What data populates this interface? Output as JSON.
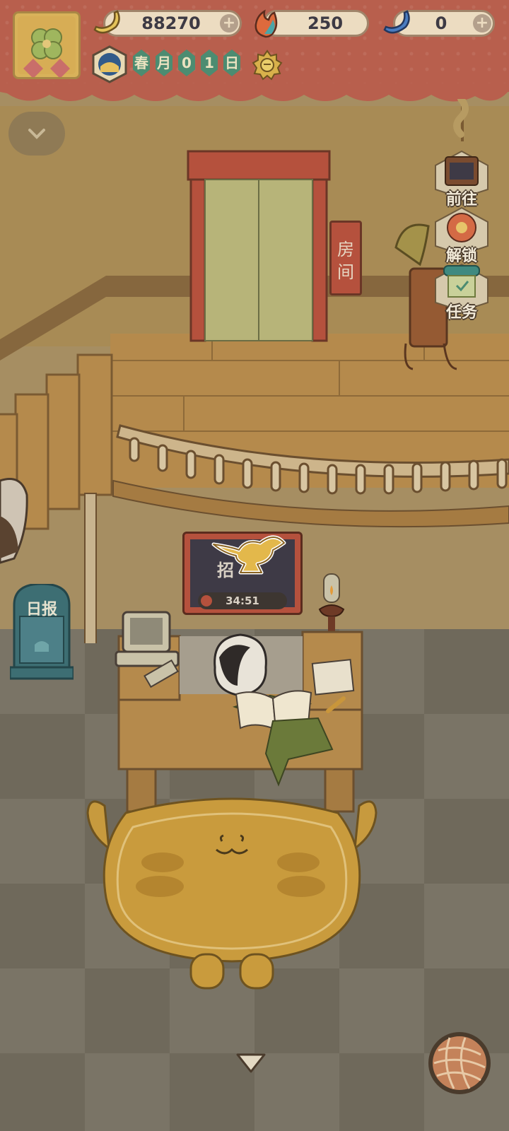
{
  "resources": {
    "banana": {
      "value": "88270",
      "icon": "banana-icon"
    },
    "fire_fruit": {
      "value": "250",
      "icon": "fire-fruit-icon"
    },
    "blue_banana": {
      "value": "0",
      "icon": "blue-banana-icon"
    }
  },
  "calendar": {
    "chars": [
      "春",
      "月",
      "0",
      "1",
      "日"
    ],
    "weather_icon": "sun-icon"
  },
  "side_menu": {
    "goto_label": "前往",
    "unlock_label": "解锁",
    "tasks_label": "任务"
  },
  "scene": {
    "room_sign": [
      "房",
      "间"
    ],
    "daily_paper_label": "日报",
    "recruit_label": "招",
    "recruit_timer": "34:51"
  },
  "colors": {
    "banner_red": "#b85f4d",
    "chip_green": "#4c8c71",
    "pill_bg": "#ecdcc1",
    "wall": "#a88b55",
    "floor": "#7a7466"
  }
}
